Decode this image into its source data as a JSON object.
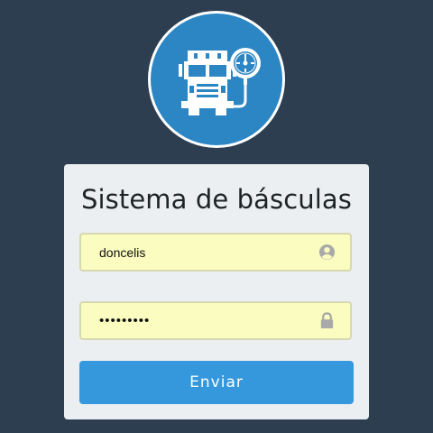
{
  "logo": {
    "icon": "truck-scale-icon",
    "background": "#2c86c4"
  },
  "login": {
    "title": "Sistema de básculas",
    "username": {
      "value": "doncelis",
      "icon": "user-icon"
    },
    "password": {
      "value": "doncelis1",
      "icon": "lock-icon"
    },
    "submit_label": "Enviar"
  },
  "colors": {
    "page_background": "#2d3e50",
    "card_background": "#eceff1",
    "input_background": "#fafdbf",
    "button_background": "#3598dc"
  }
}
